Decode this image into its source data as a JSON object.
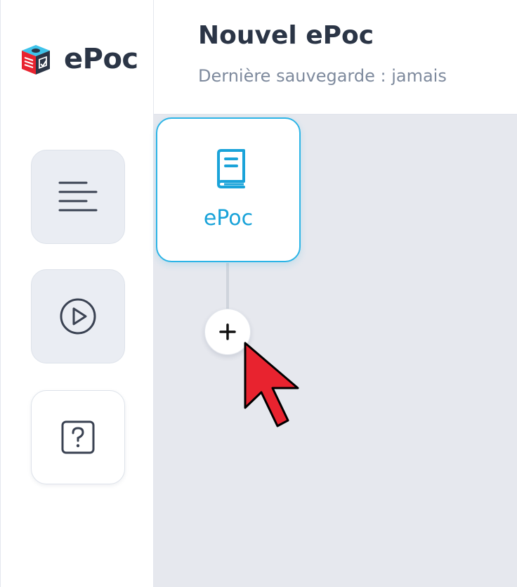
{
  "app": {
    "logo_text": "ePoc"
  },
  "header": {
    "title": "Nouvel ePoc",
    "subtitle": "Dernière sauvegarde : jamais"
  },
  "sidebar": {
    "items": [
      {
        "icon": "align-left-icon",
        "active": false
      },
      {
        "icon": "play-circle-icon",
        "active": false
      },
      {
        "icon": "help-square-icon",
        "active": false
      }
    ]
  },
  "canvas": {
    "root_node": {
      "label": "ePoc",
      "icon": "book-icon"
    },
    "add_button": {
      "icon": "plus-icon"
    }
  },
  "colors": {
    "accent": "#2cb4e6",
    "text_dark": "#2b3546",
    "text_muted": "#7e8a9d",
    "canvas_bg": "#e6e8ee",
    "cursor_red": "#e8232f"
  }
}
